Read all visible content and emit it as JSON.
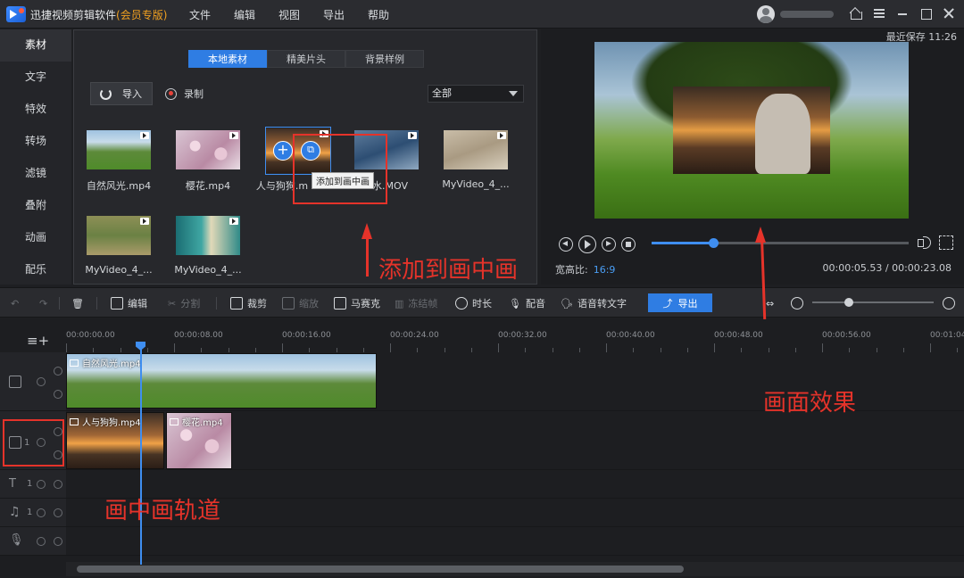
{
  "app": {
    "title": "迅捷视频剪辑软件",
    "edition": "(会员专版)"
  },
  "menu": [
    "文件",
    "编辑",
    "视图",
    "导出",
    "帮助"
  ],
  "window_icons": [
    "home-icon",
    "menu-icon",
    "minimize-icon",
    "maximize-icon",
    "close-icon"
  ],
  "sidebar": {
    "items": [
      "素材",
      "文字",
      "特效",
      "转场",
      "滤镜",
      "叠附",
      "动画",
      "配乐"
    ],
    "active": "素材"
  },
  "library": {
    "tabs": [
      "本地素材",
      "精美片头",
      "背景样例"
    ],
    "active_tab": "本地素材",
    "import_label": "导入",
    "record_label": "录制",
    "filter_value": "全部",
    "tooltip": "添加到画中画",
    "items": [
      {
        "label": "自然风光.mp4"
      },
      {
        "label": "樱花.mp4"
      },
      {
        "label": "人与狗狗.m"
      },
      {
        "label": "水.MOV"
      },
      {
        "label": "MyVideo_4_..."
      },
      {
        "label": "MyVideo_4_..."
      },
      {
        "label": "MyVideo_4_..."
      }
    ]
  },
  "preview": {
    "last_saved": "最近保存 11:26",
    "ratio_label": "宽高比:",
    "ratio_value": "16:9",
    "timecode": "00:00:05.53 / 00:00:23.08",
    "progress": 0.24
  },
  "toolbar": {
    "edit": "编辑",
    "split": "分割",
    "crop": "裁剪",
    "zoom": "缩放",
    "mosaic": "马赛克",
    "freeze": "冻结帧",
    "duration": "时长",
    "dub": "配音",
    "speech_to_text": "语音转文字",
    "export": "导出",
    "zoom_level": 0.3
  },
  "timeline": {
    "ruler": [
      "00:00:00.00",
      "00:00:08.00",
      "00:00:16.00",
      "00:00:24.00",
      "00:00:32.00",
      "00:00:40.00",
      "00:00:48.00",
      "00:00:56.00",
      "00:01:04"
    ],
    "video_track": {
      "clip": "自然风光.mp4"
    },
    "pip_track": {
      "index": "1",
      "clips": [
        "人与狗狗.mp4",
        "樱花.mp4"
      ]
    },
    "text_track": {
      "index": "1"
    },
    "music_track": {
      "index": "1"
    }
  },
  "annotations": {
    "add_pip": "添加到画中画",
    "pip_effect": "画面效果",
    "pip_track": "画中画轨道"
  },
  "colors": {
    "accent": "#2f7de3",
    "annotation": "#e5332a"
  }
}
